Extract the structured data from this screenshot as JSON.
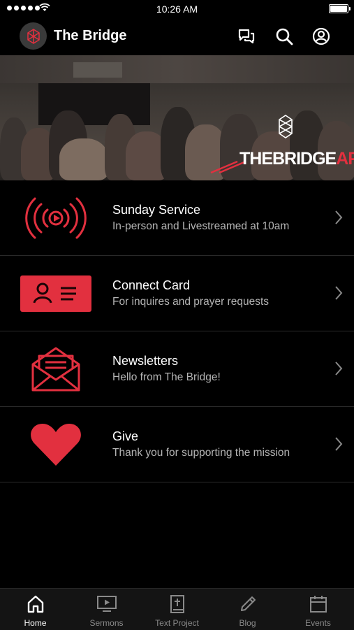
{
  "status_bar": {
    "time": "10:26 AM"
  },
  "header": {
    "title": "The Bridge",
    "icons": [
      "chat-icon",
      "search-icon",
      "account-icon"
    ]
  },
  "hero": {
    "brand_main": "THEBRIDGE",
    "brand_accent": "APP"
  },
  "menu": [
    {
      "title": "Sunday Service",
      "subtitle": "In-person and Livestreamed at 10am",
      "icon": "livestream-icon"
    },
    {
      "title": "Connect Card",
      "subtitle": "For inquires and prayer requests",
      "icon": "contact-card-icon"
    },
    {
      "title": "Newsletters",
      "subtitle": "Hello from The Bridge!",
      "icon": "envelope-icon"
    },
    {
      "title": "Give",
      "subtitle": "Thank you for supporting the mission",
      "icon": "heart-icon"
    }
  ],
  "tabs": [
    {
      "label": "Home",
      "icon": "home-icon",
      "active": true
    },
    {
      "label": "Sermons",
      "icon": "tv-icon",
      "active": false
    },
    {
      "label": "Text Project",
      "icon": "bible-icon",
      "active": false
    },
    {
      "label": "Blog",
      "icon": "pencil-icon",
      "active": false
    },
    {
      "label": "Events",
      "icon": "calendar-icon",
      "active": false
    }
  ],
  "colors": {
    "accent": "#e2303f",
    "background": "#000000",
    "tab_bar": "#141414",
    "subtitle": "#b4b4b4"
  }
}
